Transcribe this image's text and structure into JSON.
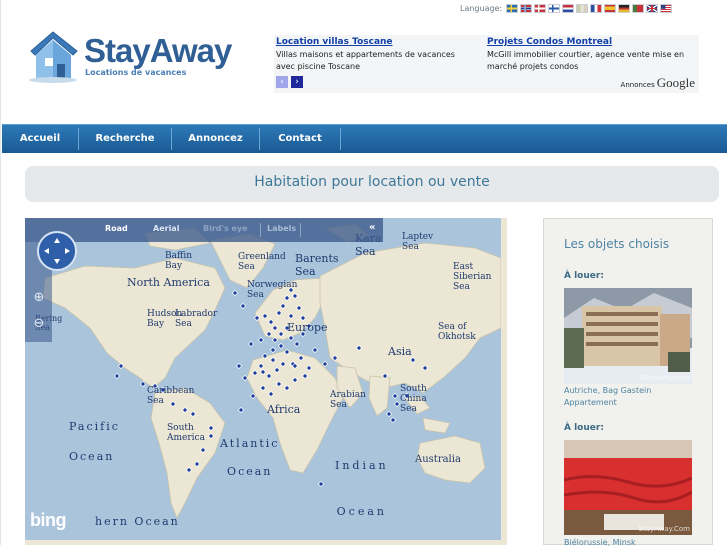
{
  "language": {
    "label": "Language:",
    "flags": [
      "swedish-flag-icon",
      "norwegian-flag-icon",
      "danish-flag-icon",
      "finnish-flag-icon",
      "dutch-flag-icon",
      "italian-flag-icon",
      "french-flag-icon",
      "spanish-flag-icon",
      "german-flag-icon",
      "portuguese-flag-icon",
      "british-flag-icon",
      "american-flag-icon"
    ]
  },
  "logo": {
    "title": "StayAway",
    "subtitle": "Locations de vacances"
  },
  "ads": {
    "items": [
      {
        "title": "Location villas Toscane",
        "text": "Villas maisons et appartements de vacances avec piscine Toscane"
      },
      {
        "title": "Projets Condos Montreal",
        "text": "McGill immobilier courtier, agence vente mise en marché projets condos"
      }
    ],
    "attribution_label": "Annonces",
    "attribution_brand": "Google",
    "prev": "‹",
    "next": "›"
  },
  "nav": {
    "items": [
      "Accueil",
      "Recherche",
      "Annoncez",
      "Contact"
    ]
  },
  "heading": "Habitation pour location ou vente",
  "map": {
    "tabs": [
      "Road",
      "Aerial",
      "Bird's eye",
      "Labels"
    ],
    "active_tab": "Road",
    "collapse": "«",
    "zoom_in": "⊕",
    "zoom_out": "⊖",
    "provider": "bing",
    "labels": {
      "baffin_bay": "Baffin\nBay",
      "greenland_sea": "Greenland\nSea",
      "barents_sea": "Barents\nSea",
      "kara_sea": "Kara\nSea",
      "laptev_sea": "Laptev\nSea",
      "east_siberian_sea": "East\nSiberian\nSea",
      "north_america": "North America",
      "norwegian_sea": "Norwegian\nSea",
      "europe": "Europe",
      "hudson_bay": "Hudson\nBay",
      "labrador_sea": "Labrador\nSea",
      "bering_sea": "Bering\nSea",
      "sea_of_okhotsk": "Sea of\nOkhotsk",
      "asia": "Asia",
      "caribbean_sea": "Caribbean\nSea",
      "arabian_sea": "Arabian\nSea",
      "south_china_sea": "South\nChina\nSea",
      "africa": "Africa",
      "pacific_ocean": "Pacific\nOcean",
      "south_america": "South\nAmerica",
      "atlantic_ocean": "Atlantic\nOcean",
      "indian_ocean": "Indian\nOcean",
      "australia": "Australia",
      "southern_ocean": "hern Ocean"
    }
  },
  "sidebar": {
    "title": "Les objets choisis",
    "items": [
      {
        "label": "À louer:",
        "caption": "Autriche, Bag Gastein\nAppartement",
        "watermark": "StayAway.com"
      },
      {
        "label": "À louer:",
        "caption": "Biélorussie, Minsk",
        "watermark": "StayAway.Com"
      }
    ]
  },
  "colors": {
    "nav": "#1f6aa8",
    "heading_text": "#3e7898",
    "logo": "#2f5f95",
    "marker": "#1e3f9e",
    "ocean": "#aac4dc",
    "land": "#ece7d4"
  }
}
